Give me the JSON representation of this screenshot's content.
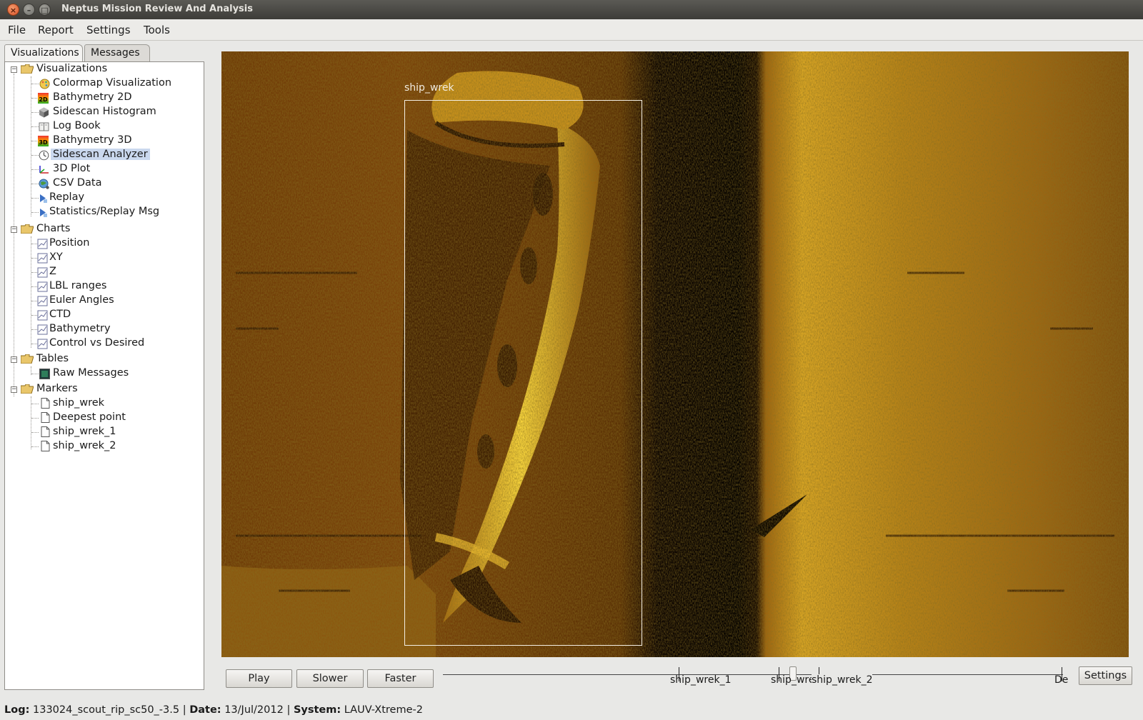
{
  "window": {
    "title": "Neptus Mission Review And Analysis",
    "close_glyph": "×",
    "min_glyph": "–",
    "max_glyph": "□"
  },
  "menubar": {
    "items": [
      "File",
      "Report",
      "Settings",
      "Tools"
    ]
  },
  "tabs": [
    "Visualizations",
    "Messages"
  ],
  "tree": {
    "visualizations": {
      "label": "Visualizations",
      "items": [
        "Colormap Visualization",
        "Bathymetry 2D",
        "Sidescan Histogram",
        "Log Book",
        "Bathymetry 3D",
        "Sidescan Analyzer",
        "3D Plot",
        "CSV Data",
        "Replay",
        "Statistics/Replay Msg"
      ]
    },
    "charts": {
      "label": "Charts",
      "items": [
        "Position",
        "XY",
        "Z",
        "LBL ranges",
        "Euler Angles",
        "CTD",
        "Bathymetry",
        "Control vs Desired"
      ]
    },
    "tables": {
      "label": "Tables",
      "items": [
        "Raw Messages"
      ]
    },
    "markers": {
      "label": "Markers",
      "items": [
        "ship_wrek",
        "Deepest point",
        "ship_wrek_1",
        "ship_wrek_2"
      ]
    },
    "icon_badges": {
      "bathymetry_2d": "2D",
      "bathymetry_3d": "3D"
    }
  },
  "sonar": {
    "marker_label": "ship_wrek"
  },
  "controls": {
    "play": "Play",
    "slower": "Slower",
    "faster": "Faster",
    "settings": "Settings",
    "timeline_marks": [
      "ship_wrek_1",
      "ship_wrek",
      "ship_wrek_2",
      "De"
    ]
  },
  "status": {
    "log_label": "Log:",
    "log_value": "133024_scout_rip_sc50_-3.5",
    "date_label": "Date:",
    "date_value": "13/Jul/2012",
    "system_label": "System:",
    "system_value": "LAUV-Xtreme-2",
    "separator": "|"
  }
}
